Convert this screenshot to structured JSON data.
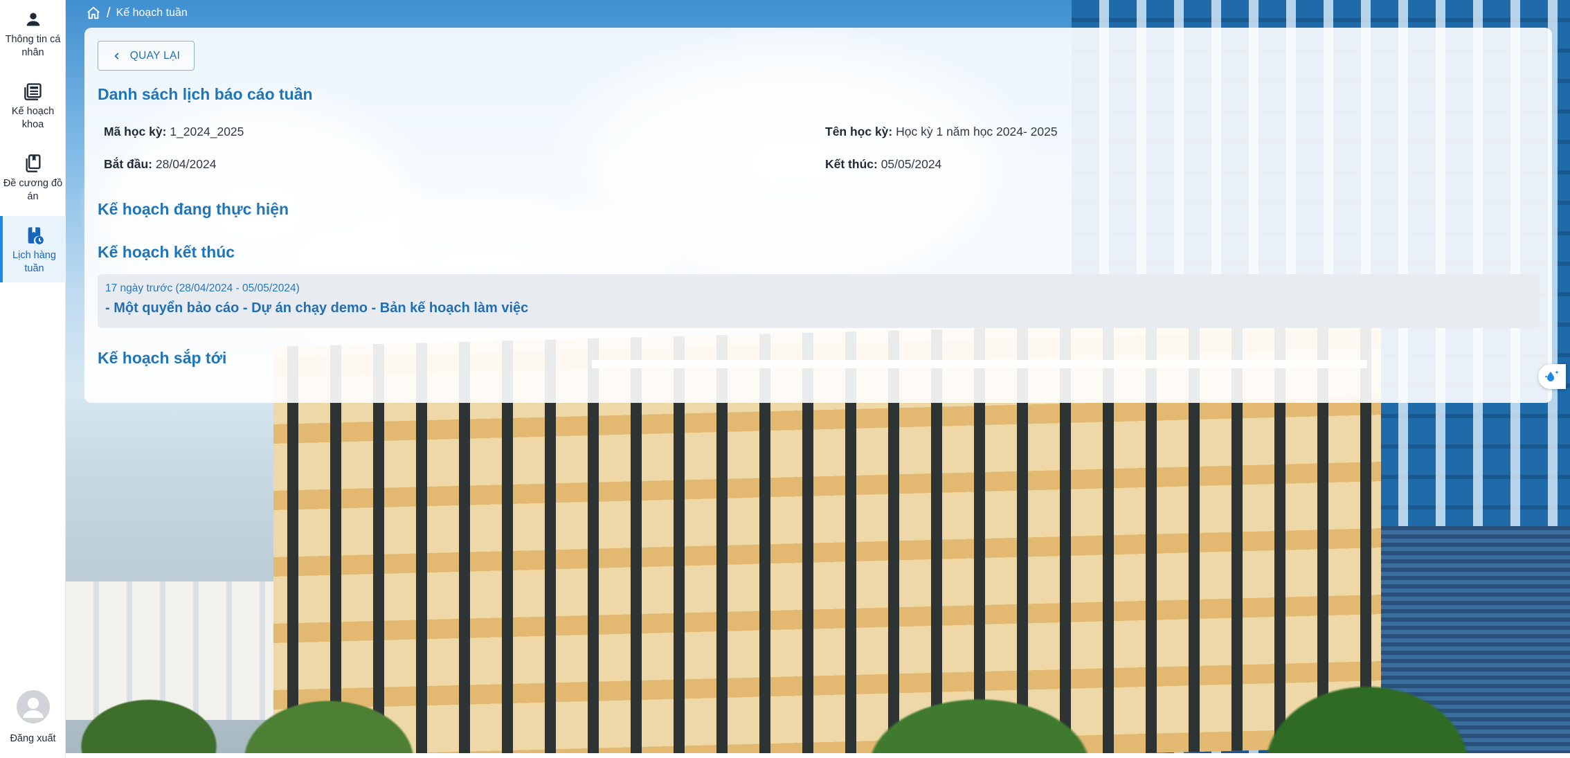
{
  "sidebar": {
    "items": [
      {
        "label": "Thông tin cá nhân",
        "icon": "person-icon"
      },
      {
        "label": "Kế hoạch khoa",
        "icon": "newspaper-icon"
      },
      {
        "label": "Đề cương đồ án",
        "icon": "book-copy-icon"
      },
      {
        "label": "Lịch hàng tuần",
        "icon": "calendar-clock-icon",
        "active": true
      }
    ],
    "logout_label": "Đăng xuất"
  },
  "breadcrumb": {
    "separator": "/",
    "current": "Kế hoạch tuần"
  },
  "card": {
    "back_label": "QUAY LẠI",
    "title": "Danh sách lịch báo cáo tuần",
    "semester_code_label": "Mã học kỳ:",
    "semester_code": "1_2024_2025",
    "semester_name_label": "Tên học kỳ:",
    "semester_name": "Học kỳ 1 năm học 2024- 2025",
    "start_label": "Bắt đầu:",
    "start_date": "28/04/2024",
    "end_label": "Kết thúc:",
    "end_date": "05/05/2024",
    "sections": {
      "in_progress": "Kế hoạch đang thực hiện",
      "finished": "Kế hoạch kết thúc",
      "upcoming": "Kế hoạch sắp tới"
    },
    "finished_items": [
      {
        "date": "17 ngày trước (28/04/2024 - 05/05/2024)",
        "title": "- Một quyển bảo cáo - Dự án chạy demo - Bản kế hoạch làm việc"
      }
    ]
  },
  "colors": {
    "accent": "#1f75b8",
    "active_nav_bg": "#e9f3fc",
    "plan_item_bg": "#e8ebef"
  }
}
